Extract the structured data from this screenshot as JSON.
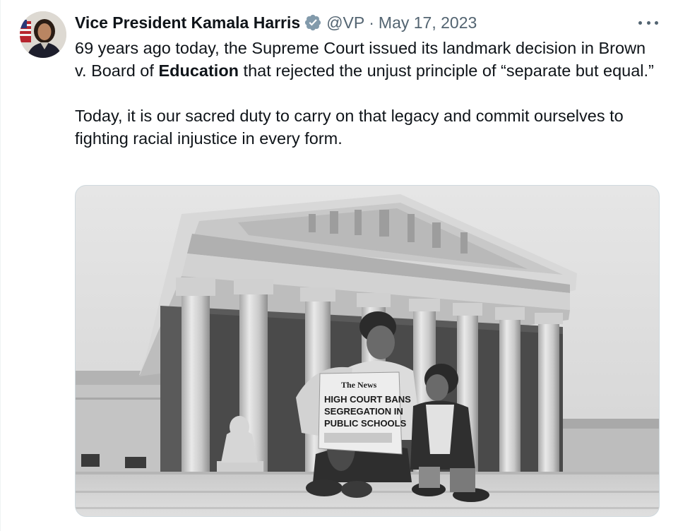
{
  "tweet": {
    "author": {
      "display_name": "Vice President Kamala Harris",
      "verified": true,
      "handle": "@VP",
      "avatar_icon": "profile-photo"
    },
    "separator": "·",
    "date": "May 17, 2023",
    "more_icon": "more-horizontal-icon",
    "text": {
      "p1_part1": "69 years ago today, the Supreme Court issued its landmark decision in Brown v. Board of ",
      "p1_bold": "Education",
      "p1_part2": " that rejected the unjust principle of “separate but equal.”",
      "p2": "Today, it is our sacred duty to carry on that legacy and commit ourselves to fighting racial injustice in every form."
    },
    "media": {
      "newspaper_masthead": "The News",
      "newspaper_headline": [
        "HIGH COURT BANS",
        "SEGREGATION IN",
        "PUBLIC SCHOOLS"
      ]
    }
  },
  "colors": {
    "text_primary": "#0f1419",
    "text_secondary": "#536471",
    "verified_badge": "#1d9bf0",
    "border": "#cfd9de"
  }
}
